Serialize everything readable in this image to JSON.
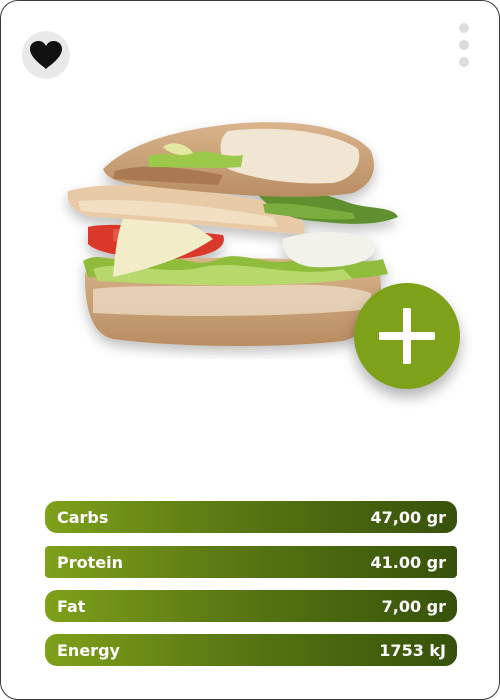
{
  "card": {
    "favorite_icon": "heart-icon",
    "more_icon": "vertical-dots-icon",
    "add_icon": "plus-icon",
    "accent_color": "#7ea11a",
    "gradient_dark": "#36520a"
  },
  "product": {
    "name": "",
    "subtitle": ""
  },
  "nutrients": [
    {
      "label": "Carbs",
      "value": "47,00 gr"
    },
    {
      "label": "Protein",
      "value": "41.00 gr"
    },
    {
      "label": "Fat",
      "value": "7,00 gr"
    },
    {
      "label": "Energy",
      "value": "1753 kJ"
    }
  ]
}
